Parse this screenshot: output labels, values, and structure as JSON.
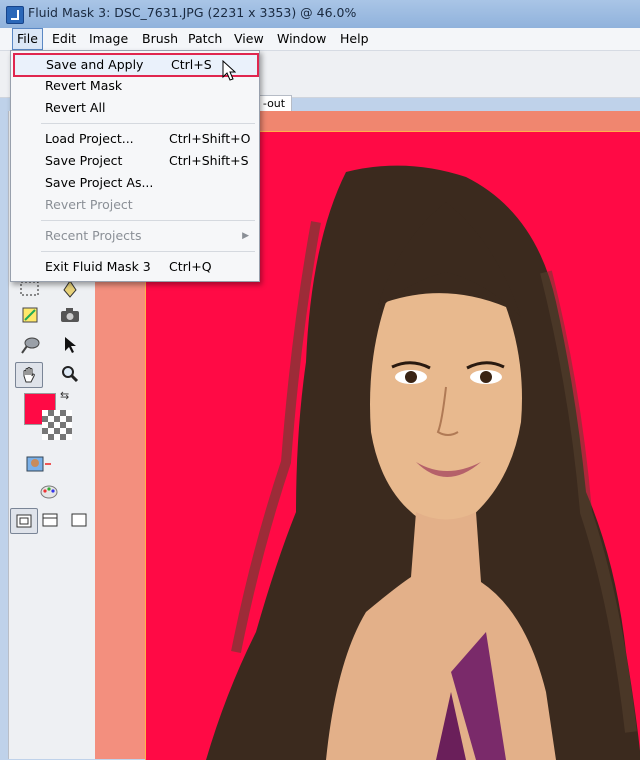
{
  "window": {
    "title": "Fluid Mask 3: DSC_7631.JPG (2231 x 3353) @ 46.0%"
  },
  "menubar": {
    "items": [
      "File",
      "Edit",
      "Image",
      "Brush",
      "Patch",
      "View",
      "Window",
      "Help"
    ],
    "active": "File"
  },
  "tabs": {
    "partial_label": "-out"
  },
  "file_menu": {
    "items": [
      {
        "label": "Save and Apply",
        "shortcut": "Ctrl+S",
        "highlighted": true
      },
      {
        "label": "Revert Mask",
        "shortcut": ""
      },
      {
        "label": "Revert All",
        "shortcut": ""
      },
      {
        "label": "Load Project...",
        "shortcut": "Ctrl+Shift+O"
      },
      {
        "label": "Save Project",
        "shortcut": "Ctrl+Shift+S"
      },
      {
        "label": "Save Project As...",
        "shortcut": ""
      },
      {
        "label": "Revert Project",
        "shortcut": "",
        "disabled": true
      },
      {
        "label": "Recent Projects",
        "shortcut": "",
        "disabled": true,
        "submenu": true
      },
      {
        "label": "Exit Fluid Mask 3",
        "shortcut": "Ctrl+Q"
      }
    ]
  },
  "colors": {
    "foreground": "#ff0a45",
    "mask_highlight": "#e0264f",
    "canvas_border": "#f38f7e"
  },
  "tools": [
    "marquee-icon",
    "pen-icon",
    "patch-icon",
    "camera-icon",
    "brush-icon",
    "pointer-icon",
    "hand-icon",
    "zoom-icon",
    "swap-icon",
    "preview-icon",
    "palette-icon",
    "view-mode-1-icon",
    "view-mode-2-icon",
    "view-mode-3-icon"
  ]
}
